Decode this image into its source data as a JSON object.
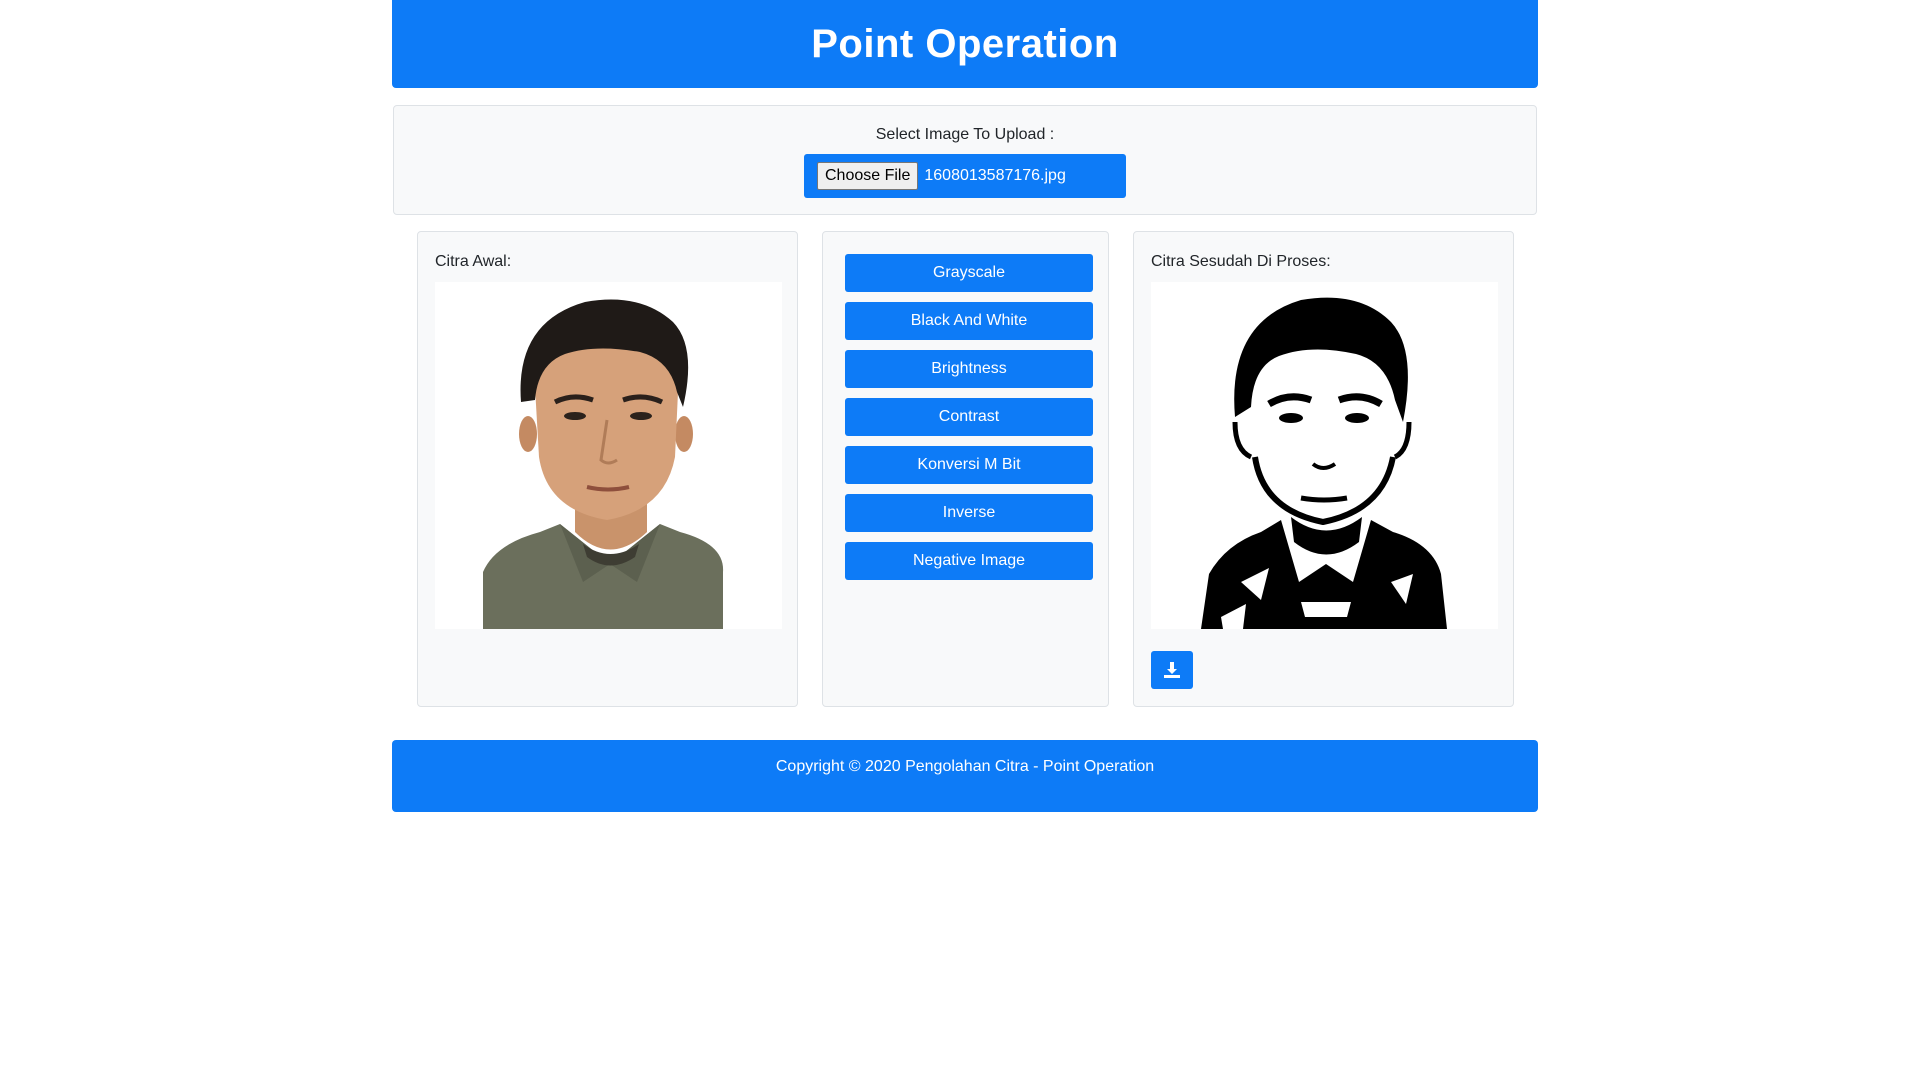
{
  "header": {
    "title": "Point Operation"
  },
  "upload": {
    "label": "Select Image To Upload :",
    "choose_file_label": "Choose File",
    "file_name": "1608013587176.jpg"
  },
  "original_card": {
    "label": "Citra Awal:"
  },
  "operations": {
    "buttons": [
      "Grayscale",
      "Black And White",
      "Brightness",
      "Contrast",
      "Konversi M Bit",
      "Inverse",
      "Negative Image"
    ]
  },
  "processed_card": {
    "label": "Citra Sesudah Di Proses:",
    "download_icon": "download-icon"
  },
  "footer": {
    "text": "Copyright © 2020 Pengolahan Citra - Point Operation"
  },
  "colors": {
    "primary": "#0d7bf7",
    "panel_bg": "#f8f9fa",
    "border": "#dee2e6"
  }
}
